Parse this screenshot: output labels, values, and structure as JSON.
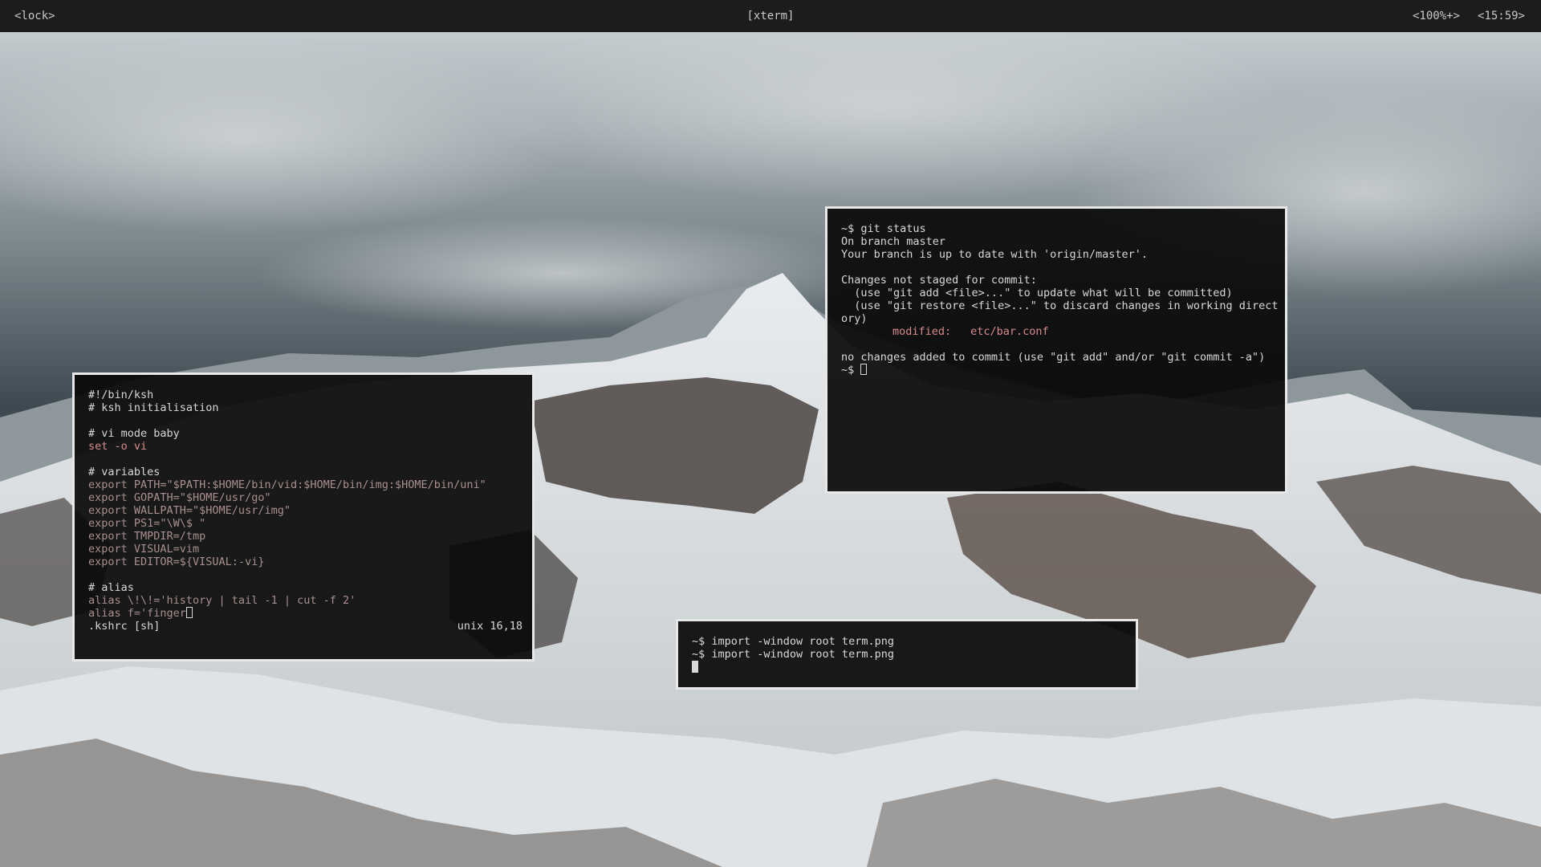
{
  "topbar": {
    "lock_label": "<lock>",
    "window_title": "[xterm]",
    "volume": "<100%+>",
    "clock": "<15:59>"
  },
  "wallpaper": {
    "icon": "mountain-landscape"
  },
  "ksh_editor": {
    "lines": [
      "#!/bin/ksh",
      "# ksh initialisation",
      "",
      "# vi mode baby",
      "set -o vi",
      "",
      "# variables",
      "export PATH=\"$PATH:$HOME/bin/vid:$HOME/bin/img:$HOME/bin/uni\"",
      "export GOPATH=\"$HOME/usr/go\"",
      "export WALLPATH=\"$HOME/usr/img\"",
      "export PS1=\"\\W\\$ \"",
      "export TMPDIR=/tmp",
      "export VISUAL=vim",
      "export EDITOR=${VISUAL:-vi}",
      "",
      "# alias",
      "alias \\!\\!='history | tail -1 | cut -f 2'",
      "alias f='finger"
    ],
    "status_file": ".kshrc [sh]",
    "status_pos": "unix 16,18"
  },
  "git_term": {
    "prompt": "~$ ",
    "command": "git status",
    "output": [
      "On branch master",
      "Your branch is up to date with 'origin/master'.",
      "",
      "Changes not staged for commit:",
      "  (use \"git add <file>...\" to update what will be committed)",
      "  (use \"git restore <file>...\" to discard changes in working direct",
      "ory)"
    ],
    "modified_label": "modified:",
    "modified_file": "etc/bar.conf",
    "summary": "no changes added to commit (use \"git add\" and/or \"git commit -a\")",
    "final_prompt": "~$ "
  },
  "import_term": {
    "lines": [
      "~$ import -window root term.png",
      "~$ import -window root term.png"
    ]
  },
  "colors": {
    "keyword": "#d98b8b",
    "string": "#a98f8f",
    "border": "#e8e8e8",
    "bar_bg": "#1c1c1c"
  }
}
